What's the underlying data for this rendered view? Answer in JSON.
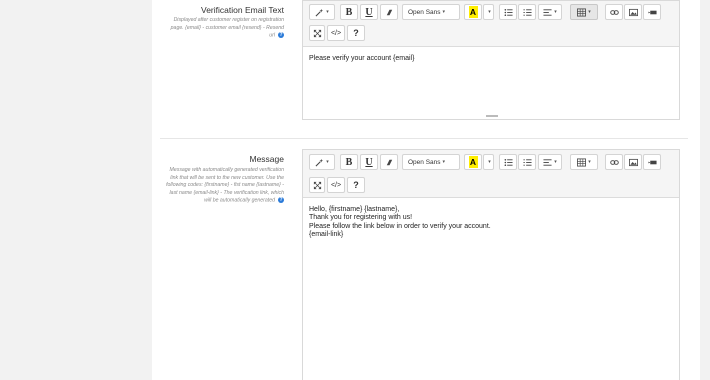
{
  "sections": [
    {
      "label": "Verification Email Text",
      "help": "Displayed after customer register on registration page. {email} - customer email {resend} - Resend url",
      "content_lines": [
        "Please verify your account {email}"
      ]
    },
    {
      "label": "Message",
      "help": "Message with automatically generated verification link that will be sent to the new customer. Use the following codes: {firstname} - fist name {lastname} - last name {email-link} - The verification link, which will be automatically generated",
      "content_lines": [
        "Hello, {firstname} {lastname},",
        "Thank you for registering with us!",
        "Please follow the link below in order to verify your account.",
        "{email-link}"
      ]
    }
  ],
  "toolbar": {
    "font_name": "Open Sans",
    "bold": "B",
    "underline": "U",
    "code_label": "</>",
    "help_label": "?",
    "font_color_letter": "A",
    "help_badge": "?",
    "icons": [
      "magic-icon",
      "eraser-icon",
      "unordered-list-icon",
      "ordered-list-icon",
      "paragraph-align-icon",
      "table-icon",
      "link-icon",
      "picture-icon",
      "video-icon",
      "fullscreen-icon"
    ]
  },
  "colors": {
    "page_bg": "#f2f2f2",
    "highlight_yellow": "#ffee00",
    "help_badge": "#2a7ad8"
  }
}
